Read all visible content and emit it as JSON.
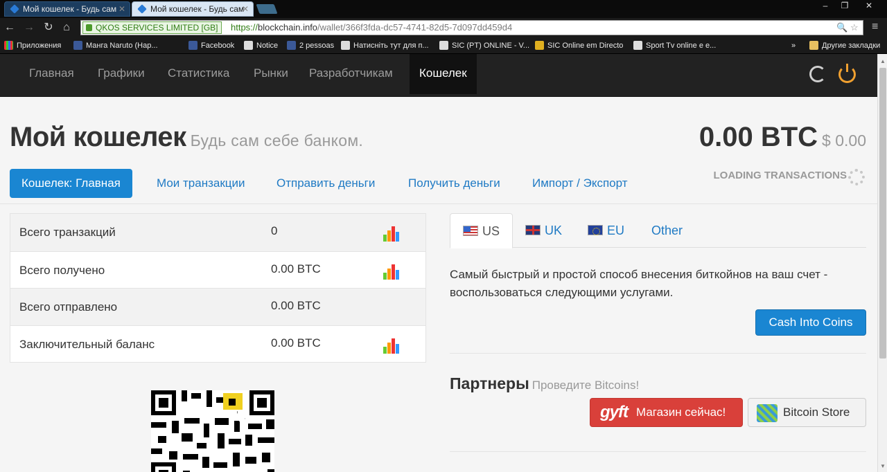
{
  "browser": {
    "tabs": [
      {
        "title": "Мой кошелек - Будь сам"
      },
      {
        "title": "Мой кошелек - Будь сам"
      }
    ],
    "ev_label": "QKOS SERVICES LIMITED [GB]",
    "url_scheme": "https://",
    "url_host": "blockchain.info",
    "url_path": "/wallet/366f3fda-dc57-4741-82d5-7d097dd459d4",
    "bookmarks": [
      "Приложения",
      "Манга Naruto (Нар...",
      "Facebook",
      "Notice",
      "2 pessoas",
      "Натисніть тут для п...",
      "SIC (PT) ONLINE - V...",
      "SIC Online em Directo",
      "Sport Tv online e e..."
    ],
    "bookmarks_more": "»",
    "other_bookmarks": "Другие закладки"
  },
  "nav": {
    "items": [
      "Главная",
      "Графики",
      "Статистика",
      "Рынки",
      "Разработчикам",
      "Кошелек"
    ],
    "active_index": 5
  },
  "header": {
    "title": "Мой кошелек",
    "subtitle": "Будь сам себе банком.",
    "balance_btc": "0.00 BTC",
    "balance_usd": "$ 0.00"
  },
  "pills": {
    "items": [
      "Кошелек: Главная",
      "Мои транзакции",
      "Отправить деньги",
      "Получить деньги",
      "Импорт / Экспорт"
    ],
    "loading": "LOADING TRANSACTIONS"
  },
  "stats": {
    "rows": [
      {
        "label": "Всего транзакций",
        "value": "0",
        "chart": true
      },
      {
        "label": "Всего получено",
        "value": "0.00 BTC",
        "chart": true
      },
      {
        "label": "Всего отправлено",
        "value": "0.00 BTC",
        "chart": false
      },
      {
        "label": "Заключительный баланс",
        "value": "0.00 BTC",
        "chart": true
      }
    ]
  },
  "exchange": {
    "tabs": [
      "US",
      "UK",
      "EU",
      "Other"
    ],
    "description": "Самый быстрый и простой способ внесения биткойнов на ваш счет - воспользоваться следующими услугами.",
    "button": "Cash Into Coins"
  },
  "partners": {
    "title": "Партнеры",
    "subtitle": "Проведите Bitcoins!",
    "gyft_logo": "gyft",
    "gyft_label": "Магазин сейчас!",
    "bitcoin_store_label": "Bitcoin Store"
  },
  "colors": {
    "accent": "#1a86d2",
    "link": "#1f7ac4",
    "power": "#f0a030",
    "gyft": "#d9403a"
  }
}
